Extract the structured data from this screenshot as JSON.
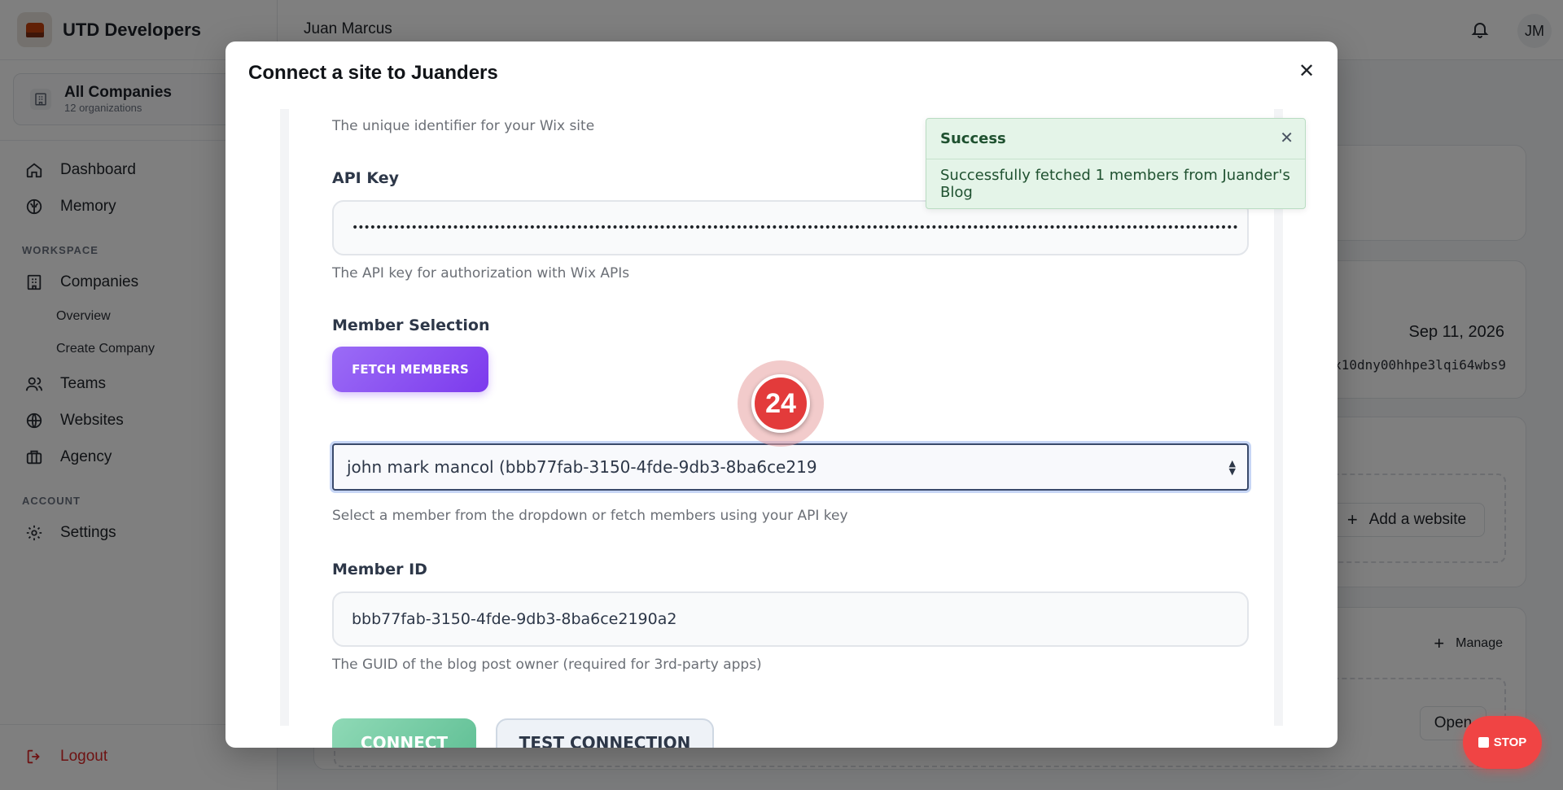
{
  "sidebar": {
    "brand": "UTD Developers",
    "company": {
      "title": "All Companies",
      "subtitle": "12 organizations"
    },
    "nav": {
      "dashboard": "Dashboard",
      "memory": "Memory",
      "workspace_label": "WORKSPACE",
      "companies": "Companies",
      "overview": "Overview",
      "create_company": "Create Company",
      "teams": "Teams",
      "websites": "Websites",
      "agency": "Agency",
      "account_label": "ACCOUNT",
      "settings": "Settings",
      "logout": "Logout"
    }
  },
  "topbar": {
    "user": "Juan Marcus",
    "avatar": "JM"
  },
  "background": {
    "date": "Sep 11, 2026",
    "code": "x10dny00hhpe3lqi64wbs9",
    "add_website": "Add a website",
    "manage": "Manage",
    "open": "Open"
  },
  "modal": {
    "title": "Connect a site to Juanders",
    "site_id_help": "The unique identifier for your Wix site",
    "api_key": {
      "label": "API Key",
      "value": "••••••••••••••••••••••••••••••••••••••••••••••••••••••••••••••••••••••••••••••••••••••••••••••••••••••••••••••••••••••••••••••••••••••••••••••••••••••",
      "help": "The API key for authorization with Wix APIs"
    },
    "member_selection": {
      "label": "Member Selection",
      "fetch_button": "FETCH MEMBERS",
      "selected": "john mark mancol (bbb77fab-3150-4fde-9db3-8ba6ce219",
      "help": "Select a member from the dropdown or fetch members using your API key"
    },
    "member_id": {
      "label": "Member ID",
      "value": "bbb77fab-3150-4fde-9db3-8ba6ce2190a2",
      "help": "The GUID of the blog post owner (required for 3rd-party apps)"
    },
    "connect_button": "CONNECT",
    "test_button": "TEST CONNECTION"
  },
  "toast": {
    "title": "Success",
    "message": "Successfully fetched 1 members from Juander's Blog"
  },
  "marker": "24",
  "stop_button": "STOP",
  "colors": {
    "accent_purple": "#7c3aed",
    "connect_green": "#5fbf94",
    "toast_bg": "#e4f4e8",
    "stop_red": "#f04444",
    "marker_red": "#e33b3b"
  }
}
